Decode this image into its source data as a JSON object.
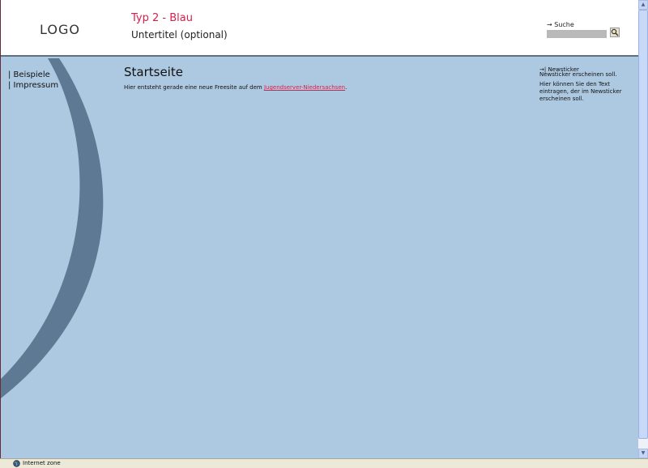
{
  "header": {
    "logo": "LOGO",
    "title": "Typ 2 - Blau",
    "subtitle": "Untertitel (optional)"
  },
  "search": {
    "label": "→ Suche",
    "value": "",
    "button_icon": "search-icon"
  },
  "sidebar": {
    "items": [
      {
        "label": "| Beispiele"
      },
      {
        "label": "| Impressum"
      }
    ]
  },
  "main": {
    "heading": "Startseite",
    "intro_before": "Hier entsteht gerade eine neue Freesite auf dem ",
    "intro_link": "Jugendserver-Niedersachsen",
    "intro_after": "."
  },
  "newsticker": {
    "heading": "→| Newsticker",
    "scrolling_text": "Newsticker erscheinen soll.",
    "body": "Hier können Sie den Text eintragen, der im Newsticker erscheinen soll."
  },
  "statusbar": {
    "text": "Internet zone"
  },
  "colors": {
    "accent": "#d61f4b",
    "background": "#adc9e1",
    "arc": "#5e7993"
  }
}
